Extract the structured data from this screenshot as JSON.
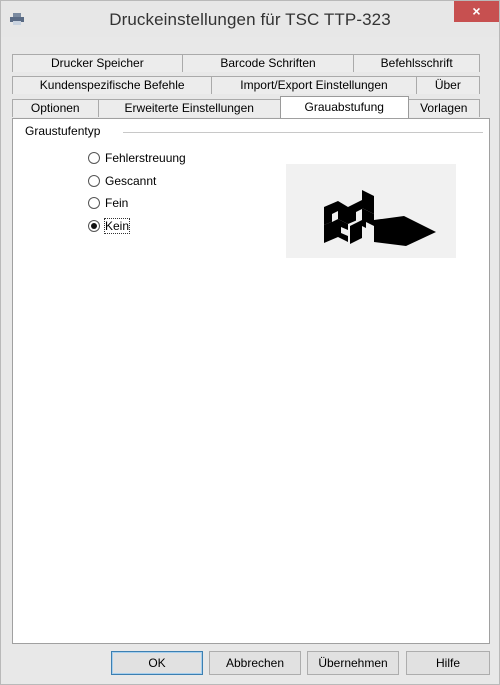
{
  "window": {
    "title": "Druckeinstellungen für TSC TTP-323",
    "close_glyph": "×",
    "icon": "printer-icon"
  },
  "tabs": {
    "row1": [
      "Drucker Speicher",
      "Barcode Schriften",
      "Befehlsschrift"
    ],
    "row2": [
      "Kundenspezifische Befehle",
      "Import/Export Einstellungen",
      "Über"
    ],
    "row3": [
      "Optionen",
      "Erweiterte Einstellungen",
      "Grauabstufung",
      "Vorlagen"
    ],
    "active": "Grauabstufung"
  },
  "grayscale": {
    "group_label": "Graustufentyp",
    "options": [
      "Fehlerstreuung",
      "Gescannt",
      "Fein",
      "Kein"
    ],
    "selected": "Kein"
  },
  "buttons": {
    "ok": "OK",
    "cancel": "Abbrechen",
    "apply": "Übernehmen",
    "help": "Hilfe"
  }
}
